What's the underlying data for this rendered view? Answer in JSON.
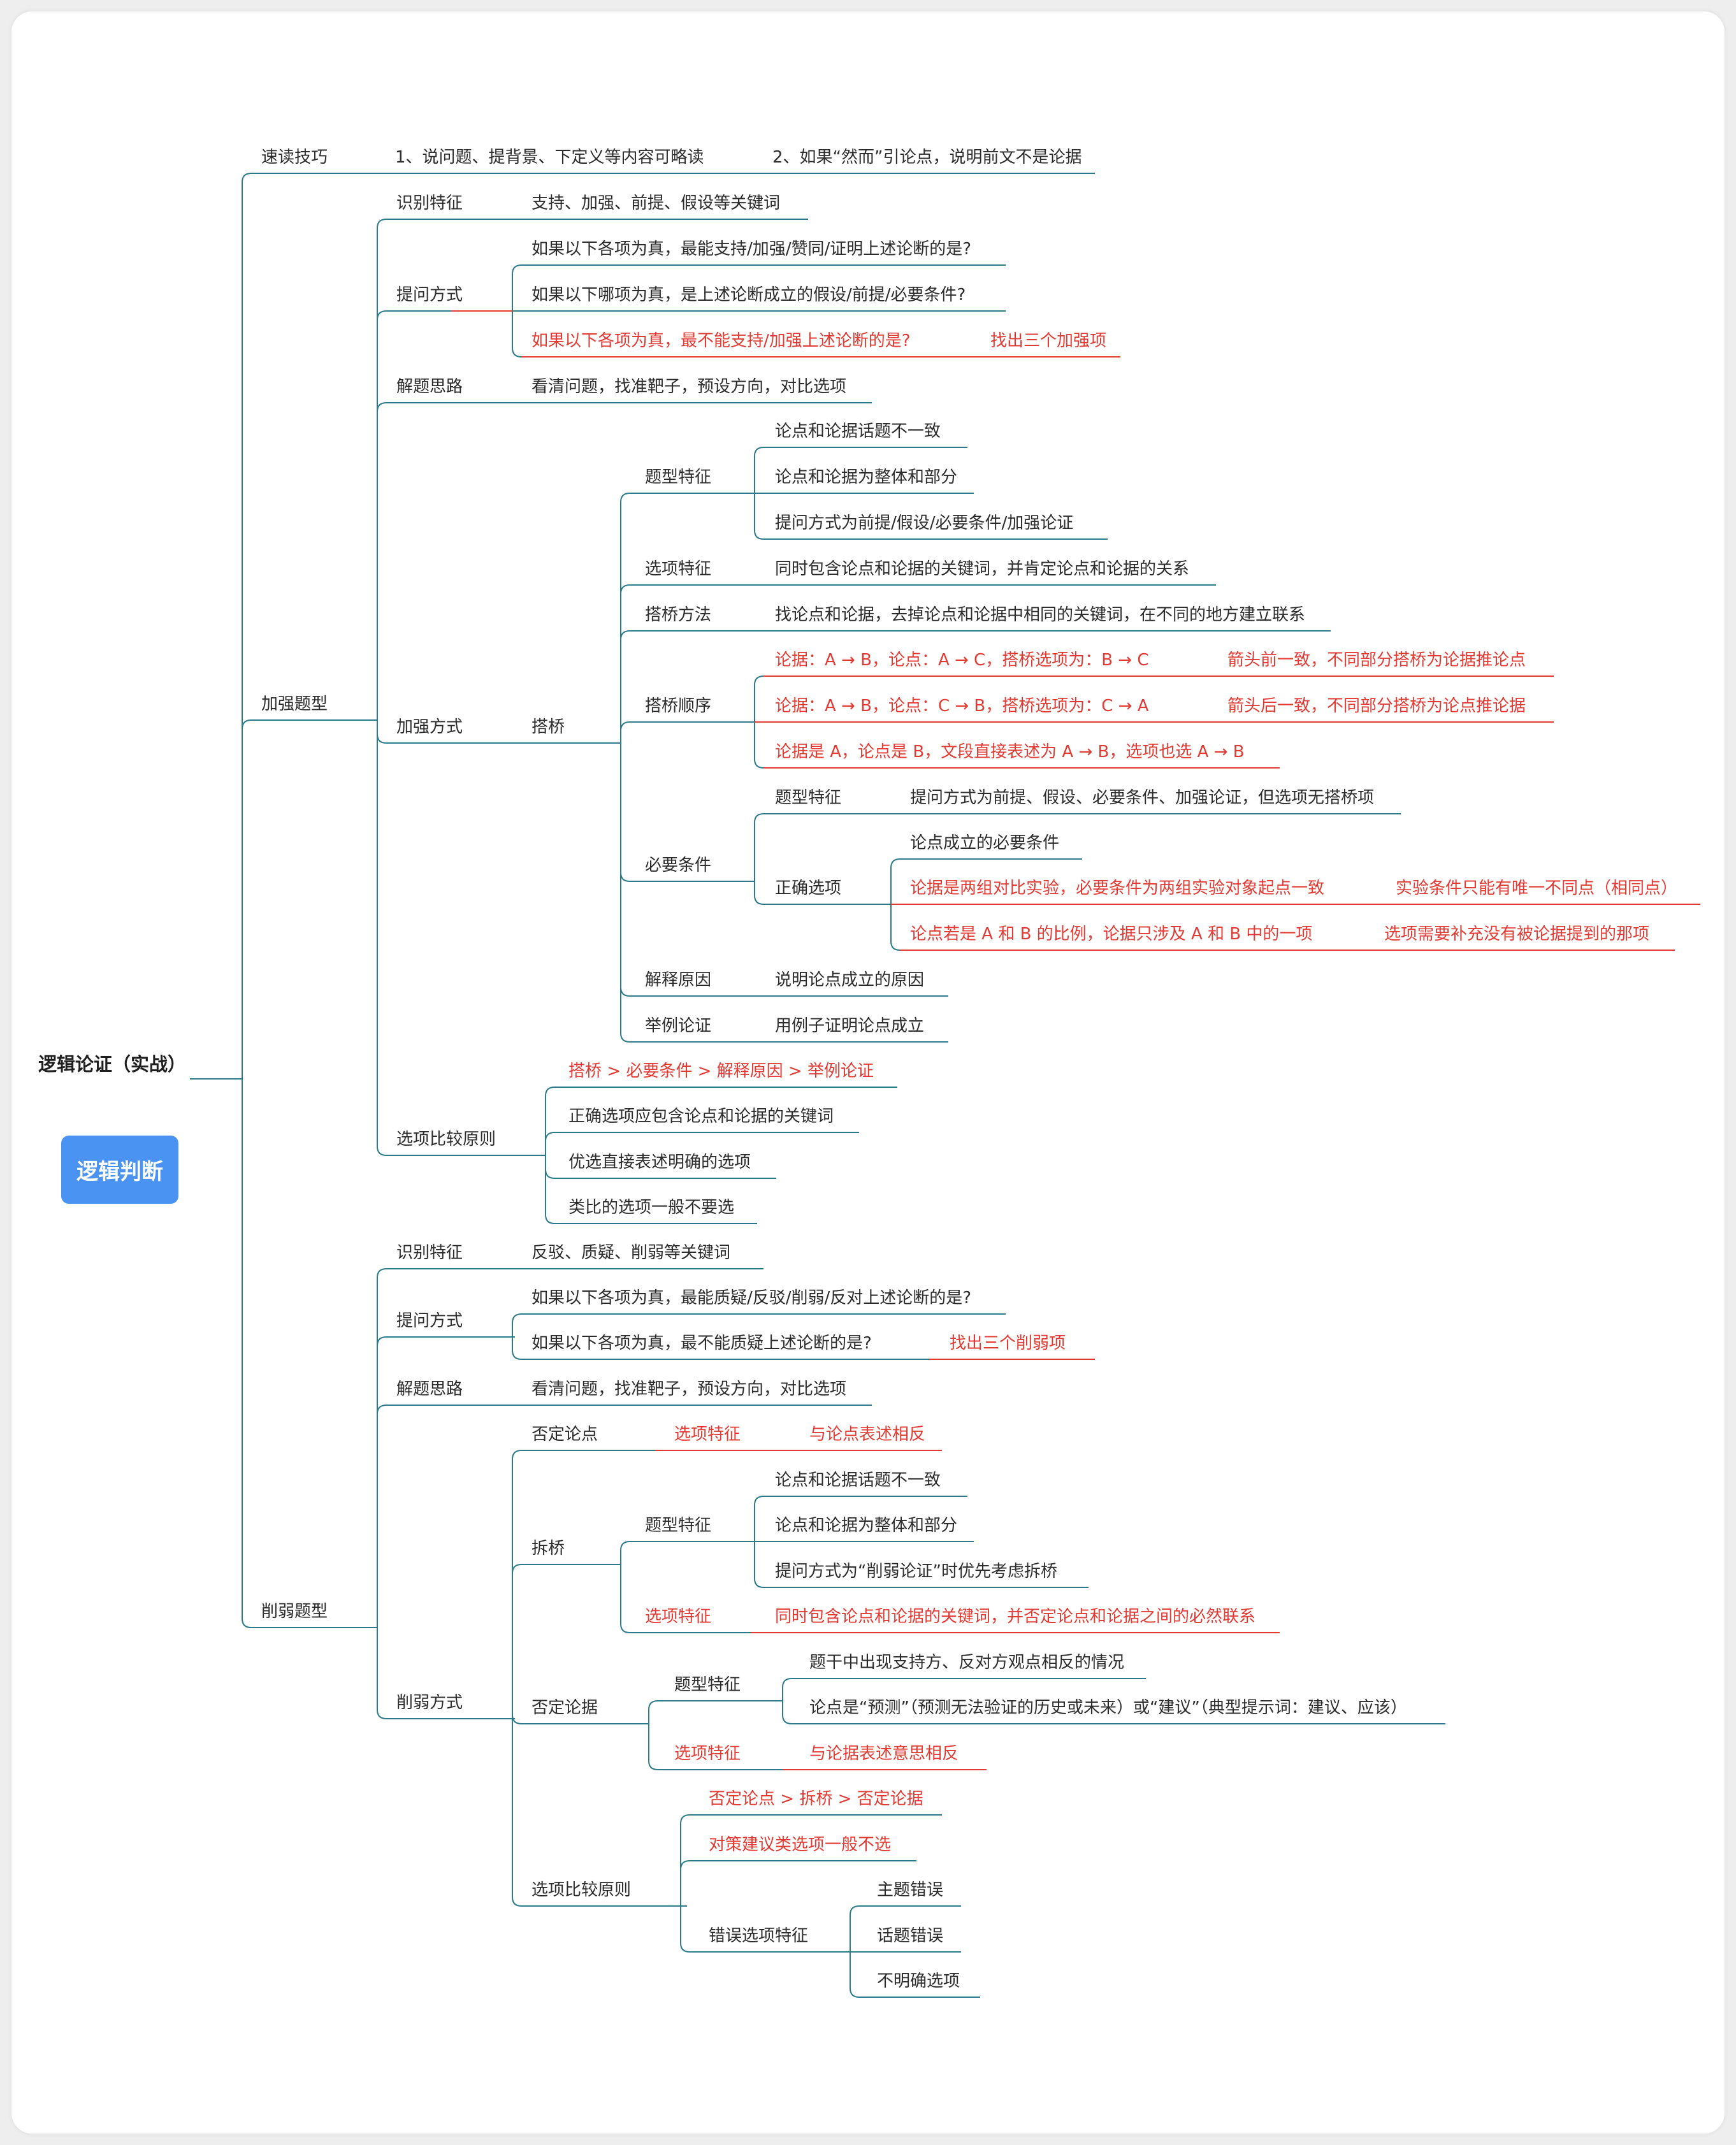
{
  "badge": {
    "label": "逻辑判断"
  },
  "colors": {
    "line": "#2b7a8a",
    "red_line": "#e23a33",
    "red_text": "#e23a33",
    "badge": "#4a93f2"
  },
  "mindmap": {
    "root": "逻辑论证（实战）",
    "speed": {
      "label": "速读技巧",
      "items": [
        "1、说问题、提背景、下定义等内容可略读",
        "2、如果“然而”引论点，说明前文不是论据"
      ]
    },
    "strengthen": {
      "label": "加强题型",
      "identify": {
        "label": "识别特征",
        "text": "支持、加强、前提、假设等关键词"
      },
      "question": {
        "label": "提问方式",
        "items": [
          "如果以下各项为真，最能支持/加强/赞同/证明上述论断的是?",
          "如果以下哪项为真，是上述论断成立的假设/前提/必要条件?",
          "如果以下各项为真，最不能支持/加强上述论断的是?"
        ],
        "note": "找出三个加强项"
      },
      "approach": {
        "label": "解题思路",
        "text": "看清问题，找准靶子，预设方向，对比选项"
      },
      "methods": {
        "label": "加强方式",
        "bridge": {
          "label": "搭桥",
          "type_feature": {
            "label": "题型特征",
            "items": [
              "论点和论据话题不一致",
              "论点和论据为整体和部分",
              "提问方式为前提/假设/必要条件/加强论证"
            ]
          },
          "option_feature": {
            "label": "选项特征",
            "text": "同时包含论点和论据的关键词，并肯定论点和论据的关系"
          },
          "method": {
            "label": "搭桥方法",
            "text": "找论点和论据，去掉论点和论据中相同的关键词，在不同的地方建立联系"
          },
          "order": {
            "label": "搭桥顺序",
            "items": [
              {
                "text": "论据：A → B，论点：A → C，搭桥选项为：B → C",
                "note": "箭头前一致，不同部分搭桥为论据推论点"
              },
              {
                "text": "论据：A → B，论点：C → B，搭桥选项为：C → A",
                "note": "箭头后一致，不同部分搭桥为论点推论据"
              },
              {
                "text": "论据是 A，论点是 B，文段直接表述为 A → B，选项也选 A → B"
              }
            ]
          }
        },
        "necessary": {
          "label": "必要条件",
          "type_feature": {
            "label": "题型特征",
            "text": "提问方式为前提、假设、必要条件、加强论证，但选项无搭桥项"
          },
          "correct": {
            "label": "正确选项",
            "items": [
              {
                "text": "论点成立的必要条件"
              },
              {
                "text": "论据是两组对比实验，必要条件为两组实验对象起点一致",
                "note": "实验条件只能有唯一不同点（相同点）"
              },
              {
                "text": "论点若是 A 和 B 的比例，论据只涉及 A 和 B 中的一项",
                "note": "选项需要补充没有被论据提到的那项"
              }
            ]
          }
        },
        "explain": {
          "label": "解释原因",
          "text": "说明论点成立的原因"
        },
        "example": {
          "label": "举例论证",
          "text": "用例子证明论点成立"
        }
      },
      "compare": {
        "label": "选项比较原则",
        "items": [
          "搭桥 > 必要条件 > 解释原因 > 举例论证",
          "正确选项应包含论点和论据的关键词",
          "优选直接表述明确的选项",
          "类比的选项一般不要选"
        ]
      }
    },
    "weaken": {
      "label": "削弱题型",
      "identify": {
        "label": "识别特征",
        "text": "反驳、质疑、削弱等关键词"
      },
      "question": {
        "label": "提问方式",
        "items": [
          "如果以下各项为真，最能质疑/反驳/削弱/反对上述论断的是?",
          "如果以下各项为真，最不能质疑上述论断的是?"
        ],
        "note": "找出三个削弱项"
      },
      "approach": {
        "label": "解题思路",
        "text": "看清问题，找准靶子，预设方向，对比选项"
      },
      "methods": {
        "label": "削弱方式",
        "deny_point": {
          "label": "否定论点",
          "feature": "选项特征",
          "text": "与论点表述相反"
        },
        "break_bridge": {
          "label": "拆桥",
          "type_feature": {
            "label": "题型特征",
            "items": [
              "论点和论据话题不一致",
              "论点和论据为整体和部分",
              "提问方式为“削弱论证”时优先考虑拆桥"
            ]
          },
          "option_feature": {
            "label": "选项特征",
            "text": "同时包含论点和论据的关键词，并否定论点和论据之间的必然联系"
          }
        },
        "deny_evidence": {
          "label": "否定论据",
          "type_feature": {
            "label": "题型特征",
            "items": [
              "题干中出现支持方、反对方观点相反的情况",
              "论点是“预测”（预测无法验证的历史或未来）或“建议”（典型提示词：建议、应该）"
            ]
          },
          "option_feature": {
            "label": "选项特征",
            "text": "与论据表述意思相反"
          }
        },
        "compare": {
          "label": "选项比较原则",
          "items": [
            "否定论点 > 拆桥 > 否定论据",
            "对策建议类选项一般不选"
          ],
          "wrong": {
            "label": "错误选项特征",
            "items": [
              "主题错误",
              "话题错误",
              "不明确选项"
            ]
          }
        }
      }
    }
  }
}
